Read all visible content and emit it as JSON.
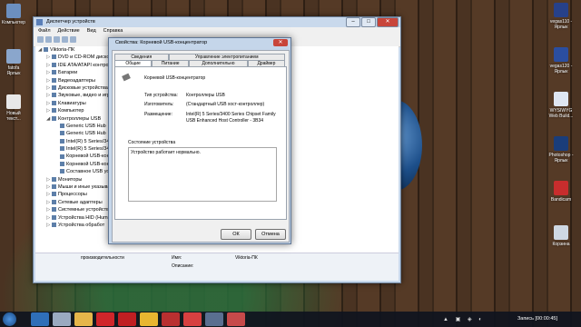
{
  "desktop_icons_left": [
    {
      "label": "Компьютер",
      "color": "#6c8fbf"
    },
    {
      "label": "fatofa\nЯрлык",
      "color": "#8aa6cc"
    },
    {
      "label": "Новый\nтекст...",
      "color": "#e8e8e8"
    }
  ],
  "desktop_icons_right": [
    {
      "label": "vegas110 -\nЯрлык",
      "color": "#27418a"
    },
    {
      "label": "vegas120 -\nЯрлык",
      "color": "#2b4ea0"
    },
    {
      "label": "WYSIWYG\nWeb Build...",
      "color": "#dfe6f2"
    },
    {
      "label": "Photoshop -\nЯрлык",
      "color": "#1a3d7a"
    },
    {
      "label": "Bandicam",
      "color": "#c82d2d"
    },
    {
      "label": "Корзина",
      "color": "#cfd8e3"
    }
  ],
  "window": {
    "title": "Диспетчер устройств",
    "menu": [
      "Файл",
      "Действие",
      "Вид",
      "Справка"
    ],
    "tree": [
      {
        "label": "Viktoria-ПК",
        "indent": 0,
        "expander": "◢"
      },
      {
        "label": "DVD и CD-ROM дисково",
        "indent": 1,
        "expander": "▷"
      },
      {
        "label": "IDE ATA/ATAPI контролл",
        "indent": 1,
        "expander": "▷"
      },
      {
        "label": "Батареи",
        "indent": 1,
        "expander": "▷"
      },
      {
        "label": "Видеоадаптеры",
        "indent": 1,
        "expander": "▷"
      },
      {
        "label": "Дисковые устройства",
        "indent": 1,
        "expander": "▷"
      },
      {
        "label": "Звуковые, видео и игро",
        "indent": 1,
        "expander": "▷"
      },
      {
        "label": "Клавиатуры",
        "indent": 1,
        "expander": "▷"
      },
      {
        "label": "Компьютер",
        "indent": 1,
        "expander": "▷"
      },
      {
        "label": "Контроллеры USB",
        "indent": 1,
        "expander": "◢"
      },
      {
        "label": "Generic USB Hub",
        "indent": 2,
        "expander": ""
      },
      {
        "label": "Generic USB Hub",
        "indent": 2,
        "expander": ""
      },
      {
        "label": "Intel(R) 5 Series/34",
        "indent": 2,
        "expander": ""
      },
      {
        "label": "Intel(R) 5 Series/34",
        "indent": 2,
        "expander": ""
      },
      {
        "label": "Корневой USB-конц",
        "indent": 2,
        "expander": ""
      },
      {
        "label": "Корневой USB-конц",
        "indent": 2,
        "expander": ""
      },
      {
        "label": "Составное USB уст",
        "indent": 2,
        "expander": ""
      },
      {
        "label": "Мониторы",
        "indent": 1,
        "expander": "▷"
      },
      {
        "label": "Мыши и иные указыва",
        "indent": 1,
        "expander": "▷"
      },
      {
        "label": "Процессоры",
        "indent": 1,
        "expander": "▷"
      },
      {
        "label": "Сетевые адаптеры",
        "indent": 1,
        "expander": "▷"
      },
      {
        "label": "Системные устройства",
        "indent": 1,
        "expander": "▷"
      },
      {
        "label": "Устройства HID (Human",
        "indent": 1,
        "expander": "▷"
      },
      {
        "label": "Устройства обработ",
        "indent": 1,
        "expander": "▷"
      }
    ],
    "status_left": "производительности",
    "status_mid1": "Имя:",
    "status_mid2": "Описание:",
    "status_right": "Viktoria-ПК"
  },
  "dialog": {
    "title": "Свойства: Корневой USB-концентратор",
    "tabs_top": [
      "Сведения",
      "Управление электропитанием"
    ],
    "tabs_bottom": [
      "Общие",
      "Питание",
      "Дополнительно",
      "Драйвер"
    ],
    "device_name": "Корневой USB-концентратор",
    "type_label": "Тип устройства:",
    "type_value": "Контроллеры USB",
    "maker_label": "Изготовитель:",
    "maker_value": "(Стандартный USB хост-контроллер)",
    "location_label": "Размещение:",
    "location_value1": "Intel(R) 5 Series/3400 Series Chipset Family",
    "location_value2": "USB Enhanced Host Controller - 3B34",
    "status_title": "Состояние устройства",
    "status_text": "Устройство работает нормально.",
    "ok": "ОК",
    "cancel": "Отмена"
  },
  "taskbar": {
    "apps": [
      {
        "name": "explorer",
        "color": "#2f6fb8"
      },
      {
        "name": "tools",
        "color": "#9aaac0"
      },
      {
        "name": "folder",
        "color": "#e5b64a"
      },
      {
        "name": "opera",
        "color": "#d0262a"
      },
      {
        "name": "opera2",
        "color": "#c01f22"
      },
      {
        "name": "chrome",
        "color": "#e8b630"
      },
      {
        "name": "app",
        "color": "#b83030"
      },
      {
        "name": "bandicam-rec",
        "color": "#d64040"
      },
      {
        "name": "vegas",
        "color": "#5a6f90"
      },
      {
        "name": "devmgr",
        "color": "#c64a4a"
      }
    ],
    "clock": "Запись [00:00:45]"
  }
}
